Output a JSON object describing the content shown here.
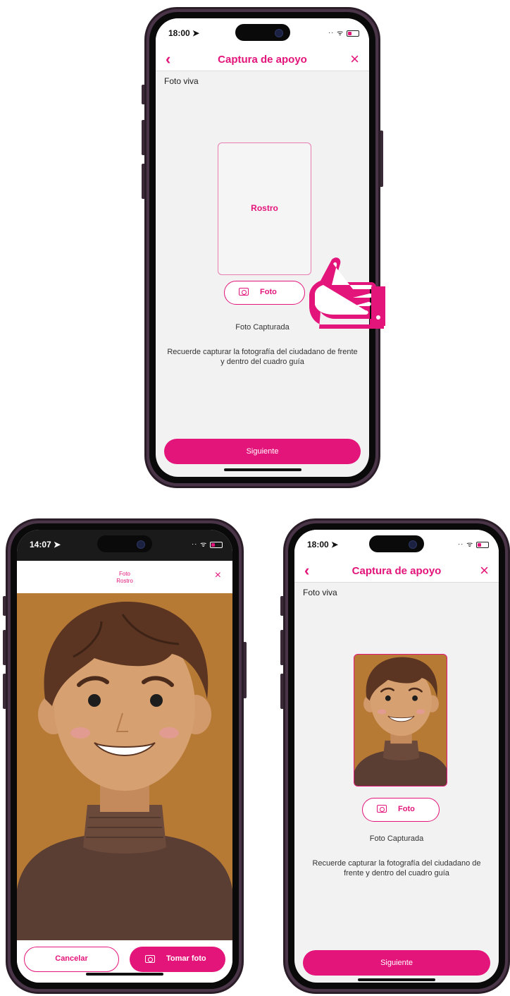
{
  "colors": {
    "accent": "#e3147a",
    "frame_border": "#e67fb0",
    "camera_bg": "#b67a35",
    "screen_bg": "#f2f2f3"
  },
  "screen_empty": {
    "status_time": "18:00 ➤",
    "nav_title": "Captura de apoyo",
    "back_icon": "chevron-left-icon",
    "close_icon": "close-icon",
    "section_label": "Foto viva",
    "frame_label": "Rostro",
    "photo_button": "Foto",
    "photo_status": "Foto Capturada",
    "hint": "Recuerde capturar la fotografía del ciudadano de frente y dentro del cuadro guía",
    "next_button": "Siguiente"
  },
  "screen_camera": {
    "status_time": "14:07 ➤",
    "header_title": "Foto",
    "header_subtitle": "Rostro",
    "cancel_button": "Cancelar",
    "take_photo_button": "Tomar foto"
  },
  "screen_captured": {
    "status_time": "18:00 ➤",
    "nav_title": "Captura de apoyo",
    "section_label": "Foto viva",
    "photo_button": "Foto",
    "photo_status": "Foto Capturada",
    "hint": "Recuerde capturar la fotografía del ciudadano de frente y dentro del cuadro guía",
    "next_button": "Siguiente"
  }
}
